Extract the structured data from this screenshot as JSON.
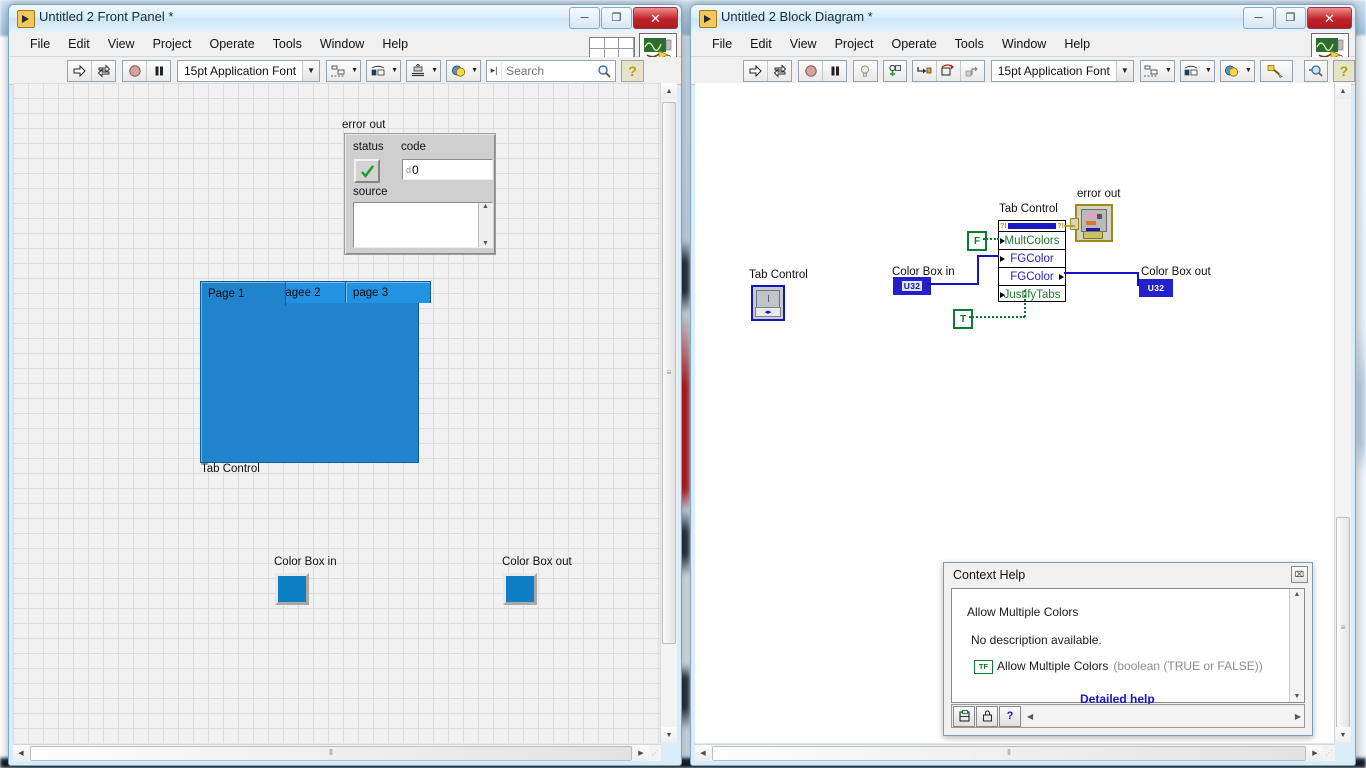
{
  "front_panel": {
    "title": "Untitled 2 Front Panel *",
    "window_buttons": {
      "minimize": "─",
      "maximize": "❐",
      "close": "✕"
    },
    "menus": [
      "File",
      "Edit",
      "View",
      "Project",
      "Operate",
      "Tools",
      "Window",
      "Help"
    ],
    "toolbar": {
      "run_label": "run-arrow",
      "run_continuous_label": "run-continuously",
      "abort_label": "abort-execution",
      "pause_label": "pause",
      "font": "15pt Application Font",
      "align_label": "align-objects",
      "distribute_label": "distribute-objects",
      "resize_label": "resize-objects",
      "reorder_label": "reorder",
      "search_placeholder": "Search",
      "search_value": "",
      "help_label": "?"
    },
    "error_cluster": {
      "title": "error out",
      "status_label": "status",
      "code_label": "code",
      "code_value": "0",
      "code_prefix": "d",
      "source_label": "source",
      "source_value": ""
    },
    "tab_control": {
      "label": "Tab Control",
      "pages": [
        "Page 1",
        "pagee 2",
        "page 3"
      ],
      "active_page": 0,
      "color": "#1f84cd"
    },
    "color_box_in": {
      "label": "Color Box in",
      "color": "#0f7dc4"
    },
    "color_box_out": {
      "label": "Color Box out",
      "color": "#0f7dc4"
    }
  },
  "block_diagram": {
    "title": "Untitled 2 Block Diagram *",
    "window_buttons": {
      "minimize": "─",
      "maximize": "❐",
      "close": "✕"
    },
    "menus": [
      "File",
      "Edit",
      "View",
      "Project",
      "Operate",
      "Tools",
      "Window",
      "Help"
    ],
    "toolbar": {
      "run_label": "run-arrow",
      "run_continuous_label": "run-continuously",
      "abort_label": "abort-execution",
      "pause_label": "pause",
      "highlight_label": "highlight-execution",
      "retain_label": "retain-wire-values",
      "step_into_label": "step-into",
      "step_over_label": "step-over",
      "step_out_label": "step-out",
      "font": "15pt Application Font",
      "align_label": "align-objects",
      "distribute_label": "distribute-objects",
      "reorder_label": "reorder",
      "cleanup_label": "clean-up-diagram",
      "search_label": "search",
      "help_label": "?"
    },
    "tab_control_terminal": {
      "label": "Tab Control"
    },
    "color_box_in_terminal": {
      "label": "Color Box in",
      "type": "U32"
    },
    "color_box_out_terminal": {
      "label": "Color Box out",
      "type": "U32"
    },
    "error_out_node": {
      "label": "error out"
    },
    "property_node": {
      "label": "Tab Control",
      "ref_left": "?!",
      "ref_right": "?!",
      "properties": [
        {
          "name": "MultColors",
          "color": "green",
          "direction": "in"
        },
        {
          "name": "FGColor",
          "color": "blue",
          "direction": "in"
        },
        {
          "name": "FGColor",
          "color": "blue",
          "direction": "out"
        },
        {
          "name": "JustifyTabs",
          "color": "green",
          "direction": "in"
        }
      ]
    },
    "constants": [
      {
        "value": "F",
        "name": "false-constant"
      },
      {
        "value": "T",
        "name": "true-constant"
      }
    ]
  },
  "context_help": {
    "title": "Context Help",
    "close_label": "⌧",
    "heading": "Allow Multiple Colors",
    "description": "No description available.",
    "type_icon": "TF",
    "param_name": "Allow Multiple Colors",
    "param_type": "(boolean (TRUE or FALSE))",
    "detailed_help": "Detailed help",
    "buttons": [
      "show-optional-terminals",
      "lock-context-help",
      "detailed-help"
    ]
  }
}
